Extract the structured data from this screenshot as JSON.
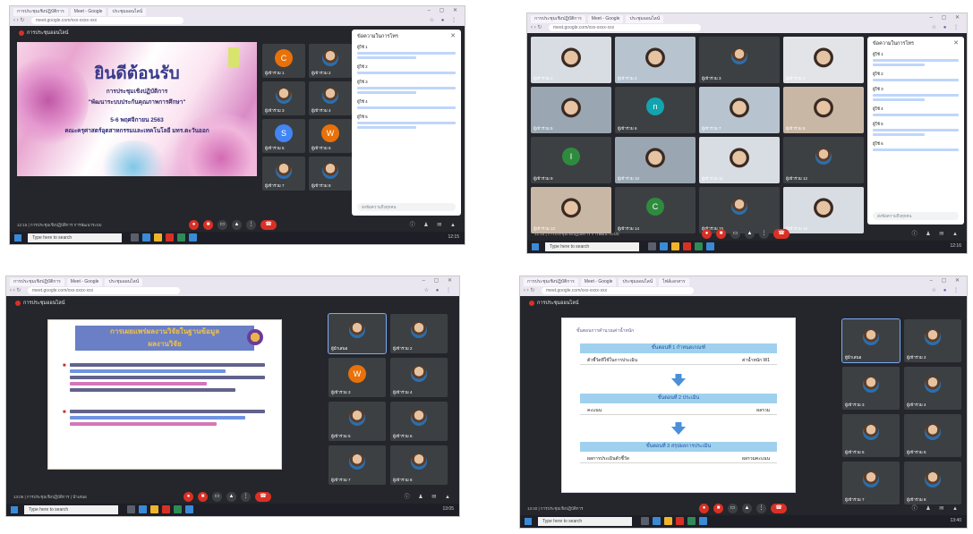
{
  "panels": [
    {
      "tabs": [
        "การประชุมเชิงปฏิบัติการ",
        "Meet - Google",
        "ประชุมออนไลน์"
      ],
      "url": "meet.google.com/xxx-xxxx-xxx",
      "meeting_title": "การประชุมออนไลน์",
      "footer_text": "12:15 | การประชุมเชิงปฏิบัติการ การพัฒนาระบบ",
      "search_placeholder": "Type here to search",
      "tray_time": "12:15",
      "slide": {
        "heading": "ยินดีต้อนรับ",
        "lines": [
          "การประชุมเชิงปฏิบัติการ",
          "\"พัฒนาระบบประกันคุณภาพการศึกษา\"",
          "5-6 พฤศจิกายน 2563",
          "คณะครุศาสตร์อุตสาหกรรมและเทคโนโลยี มทร.ตะวันออก"
        ]
      },
      "participants": [
        {
          "name": "ผู้เข้าร่วม 1",
          "initial": "C",
          "color": "#e8710a"
        },
        {
          "name": "ผู้เข้าร่วม 2",
          "initial": "",
          "color": ""
        },
        {
          "name": "ผู้เข้าร่วม 3",
          "initial": "",
          "color": ""
        },
        {
          "name": "ผู้เข้าร่วม 4",
          "initial": "",
          "color": ""
        },
        {
          "name": "ผู้เข้าร่วม 5",
          "initial": "S",
          "color": "#4285f4"
        },
        {
          "name": "ผู้เข้าร่วม 6",
          "initial": "W",
          "color": "#e8710a"
        },
        {
          "name": "ผู้เข้าร่วม 7",
          "initial": "",
          "color": ""
        },
        {
          "name": "ผู้เข้าร่วม 8",
          "initial": "",
          "color": ""
        }
      ],
      "chat": {
        "title": "ข้อความในการโทร",
        "messages": [
          "ผู้ใช้ 1",
          "ผู้ใช้ 2",
          "ผู้ใช้ 3",
          "ผู้ใช้ 4",
          "ผู้ใช้ 5"
        ],
        "input_placeholder": "ส่งข้อความถึงทุกคน"
      }
    },
    {
      "tabs": [
        "การประชุมเชิงปฏิบัติการ",
        "Meet - Google",
        "ประชุมออนไลน์"
      ],
      "url": "meet.google.com/xxx-xxxx-xxx",
      "meeting_title": "การประชุมออนไลน์",
      "footer_text": "12:15 | การประชุมเชิงปฏิบัติการ การพัฒนาระบบ",
      "search_placeholder": "Type here to search",
      "tray_time": "12:16",
      "participants": [
        {
          "name": "ผู้เข้าร่วม 1",
          "initial": "",
          "color": ""
        },
        {
          "name": "ผู้เข้าร่วม 2",
          "initial": "",
          "color": ""
        },
        {
          "name": "ผู้เข้าร่วม 3",
          "initial": "",
          "color": ""
        },
        {
          "name": "ผู้เข้าร่วม 4",
          "initial": "",
          "color": ""
        },
        {
          "name": "ผู้เข้าร่วม 5",
          "initial": "",
          "color": ""
        },
        {
          "name": "ผู้เข้าร่วม 6",
          "initial": "n",
          "color": "#12a4af"
        },
        {
          "name": "ผู้เข้าร่วม 7",
          "initial": "",
          "color": ""
        },
        {
          "name": "ผู้เข้าร่วม 8",
          "initial": "",
          "color": ""
        },
        {
          "name": "ผู้เข้าร่วม 9",
          "initial": "I",
          "color": "#2e8b3e"
        },
        {
          "name": "ผู้เข้าร่วม 10",
          "initial": "",
          "color": ""
        },
        {
          "name": "ผู้เข้าร่วม 11",
          "initial": "",
          "color": ""
        },
        {
          "name": "ผู้เข้าร่วม 12",
          "initial": "",
          "color": ""
        },
        {
          "name": "ผู้เข้าร่วม 13",
          "initial": "",
          "color": ""
        },
        {
          "name": "ผู้เข้าร่วม 14",
          "initial": "C",
          "color": "#2e8b3e"
        },
        {
          "name": "ผู้เข้าร่วม 15",
          "initial": "",
          "color": ""
        },
        {
          "name": "ผู้เข้าร่วม 16",
          "initial": "",
          "color": ""
        }
      ],
      "chat": {
        "title": "ข้อความในการโทร",
        "messages": [
          "ผู้ใช้ 1",
          "ผู้ใช้ 2",
          "ผู้ใช้ 3",
          "ผู้ใช้ 4",
          "ผู้ใช้ 5",
          "ผู้ใช้ 6"
        ],
        "input_placeholder": "ส่งข้อความถึงทุกคน"
      }
    },
    {
      "tabs": [
        "การประชุมเชิงปฏิบัติการ",
        "Meet - Google",
        "ประชุมออนไลน์"
      ],
      "url": "meet.google.com/xxx-xxxx-xxx",
      "meeting_title": "การประชุมออนไลน์",
      "footer_text": "13:05 | การประชุมเชิงปฏิบัติการ | นำเสนอ",
      "search_placeholder": "Type here to search",
      "tray_time": "13:05",
      "slide": {
        "title": "การเผยแพร่ผลงานวิจัยในฐานข้อมูล",
        "subtitle": "ผลงานวิจัย",
        "bullets": 2
      },
      "participants": [
        {
          "name": "ผู้นำเสนอ",
          "initial": "",
          "color": ""
        },
        {
          "name": "ผู้เข้าร่วม 2",
          "initial": "",
          "color": ""
        },
        {
          "name": "ผู้เข้าร่วม 3",
          "initial": "W",
          "color": "#e8710a"
        },
        {
          "name": "ผู้เข้าร่วม 4",
          "initial": "",
          "color": ""
        },
        {
          "name": "ผู้เข้าร่วม 5",
          "initial": "",
          "color": ""
        },
        {
          "name": "ผู้เข้าร่วม 6",
          "initial": "",
          "color": ""
        },
        {
          "name": "ผู้เข้าร่วม 7",
          "initial": "",
          "color": ""
        },
        {
          "name": "ผู้เข้าร่วม 8",
          "initial": "",
          "color": ""
        }
      ]
    },
    {
      "tabs": [
        "การประชุมเชิงปฏิบัติการ",
        "Meet - Google",
        "ประชุมออนไลน์",
        "ไฟล์เอกสาร"
      ],
      "url": "meet.google.com/xxx-xxxx-xxx",
      "meeting_title": "การประชุมออนไลน์",
      "footer_text": "13:40 | การประชุมเชิงปฏิบัติการ",
      "search_placeholder": "Type here to search",
      "tray_time": "13:40",
      "slide": {
        "top_label": "ขั้นตอนการคำนวณค่าน้ำหนัก",
        "bars": [
          "ขั้นตอนที่ 1 กำหนดเกณฑ์",
          "ขั้นตอนที่ 2 ประเมิน",
          "ขั้นตอนที่ 3 สรุปผลการประเมิน"
        ],
        "rows": [
          [
            "ตัวชี้วัดที่ใช้ในการประเมิน",
            "ค่าน้ำหนัก W1"
          ],
          [
            "คะแนน",
            "ผลรวม"
          ],
          [
            "ผลการประเมินตัวชี้วัด",
            "ผลรวมคะแนน"
          ]
        ]
      },
      "participants": [
        {
          "name": "ผู้นำเสนอ",
          "initial": "",
          "color": ""
        },
        {
          "name": "ผู้เข้าร่วม 2",
          "initial": "",
          "color": ""
        },
        {
          "name": "ผู้เข้าร่วม 3",
          "initial": "",
          "color": ""
        },
        {
          "name": "ผู้เข้าร่วม 4",
          "initial": "",
          "color": ""
        },
        {
          "name": "ผู้เข้าร่วม 5",
          "initial": "",
          "color": ""
        },
        {
          "name": "ผู้เข้าร่วม 6",
          "initial": "",
          "color": ""
        },
        {
          "name": "ผู้เข้าร่วม 7",
          "initial": "",
          "color": ""
        },
        {
          "name": "ผู้เข้าร่วม 8",
          "initial": "",
          "color": ""
        }
      ]
    }
  ]
}
